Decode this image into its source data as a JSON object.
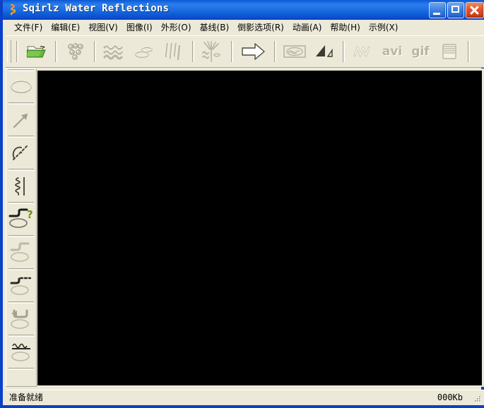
{
  "window": {
    "title": "Sqirlz Water Reflections",
    "icon": "squiggle-app-icon",
    "caption_buttons": [
      {
        "name": "minimize-button",
        "label": "_"
      },
      {
        "name": "maximize-button",
        "label": "□"
      },
      {
        "name": "close-button",
        "label": "×"
      }
    ]
  },
  "menubar": {
    "items": [
      {
        "name": "menu-file",
        "label": "文件(F)"
      },
      {
        "name": "menu-edit",
        "label": "编辑(E)"
      },
      {
        "name": "menu-view",
        "label": "视图(V)"
      },
      {
        "name": "menu-image",
        "label": "图像(I)"
      },
      {
        "name": "menu-shape",
        "label": "外形(O)"
      },
      {
        "name": "menu-baseline",
        "label": "基线(B)"
      },
      {
        "name": "menu-reflection-options",
        "label": "倒影选项(R)"
      },
      {
        "name": "menu-animation",
        "label": "动画(A)"
      },
      {
        "name": "menu-help",
        "label": "帮助(H)"
      },
      {
        "name": "menu-examples",
        "label": "示例(X)"
      }
    ]
  },
  "toolbar": {
    "buttons": [
      {
        "name": "open-file-button",
        "icon": "open-folder-icon",
        "enabled": true,
        "label": ""
      },
      {
        "name": "ripple-drops-button",
        "icon": "water-drops-icon",
        "enabled": false,
        "label": ""
      },
      {
        "name": "waves-button",
        "icon": "waves-icon",
        "enabled": false,
        "label": ""
      },
      {
        "name": "ripples-button",
        "icon": "ripple-rings-icon",
        "enabled": false,
        "label": ""
      },
      {
        "name": "rain-button",
        "icon": "rain-streaks-icon",
        "enabled": false,
        "label": ""
      },
      {
        "name": "combined-effects-button",
        "icon": "combined-effect-icon",
        "enabled": false,
        "label": ""
      },
      {
        "name": "play-button",
        "icon": "right-arrow-icon",
        "enabled": true,
        "label": ""
      },
      {
        "name": "preview-frame-button",
        "icon": "preview-frame-icon",
        "enabled": false,
        "label": ""
      },
      {
        "name": "perspective-button",
        "icon": "triangle-perspective-icon",
        "enabled": false,
        "label": ""
      },
      {
        "name": "wave-anim-button",
        "icon": "zigzag-wave-icon",
        "enabled": false,
        "label": ""
      },
      {
        "name": "export-avi-button",
        "icon": "text-label-icon",
        "enabled": false,
        "label": "avi"
      },
      {
        "name": "export-gif-button",
        "icon": "text-label-icon",
        "enabled": false,
        "label": "gif"
      },
      {
        "name": "frames-list-button",
        "icon": "stacked-lines-icon",
        "enabled": false,
        "label": ""
      }
    ]
  },
  "tool_palette": {
    "tools": [
      {
        "name": "tool-ellipse-select",
        "icon": "ellipse-icon",
        "enabled": false
      },
      {
        "name": "tool-line-draw",
        "icon": "arrow-diagonal-icon",
        "enabled": false
      },
      {
        "name": "tool-curve-edit",
        "icon": "curve-dashed-icon",
        "enabled": false
      },
      {
        "name": "tool-wave-baseline",
        "icon": "squiggle-bar-icon",
        "enabled": false
      },
      {
        "name": "tool-help-shape",
        "icon": "step-ellipse-query-icon",
        "enabled": true
      },
      {
        "name": "tool-step-shape",
        "icon": "step-ellipse-icon",
        "enabled": false
      },
      {
        "name": "tool-dashed-step-shape",
        "icon": "dashed-step-ellipse-icon",
        "enabled": false
      },
      {
        "name": "tool-arrow-step-shape",
        "icon": "arrow-step-ellipse-icon",
        "enabled": false
      },
      {
        "name": "tool-wave-line-shape",
        "icon": "wave-line-ellipse-icon",
        "enabled": false
      }
    ]
  },
  "canvas": {
    "name": "image-canvas",
    "background_color": "#000000"
  },
  "statusbar": {
    "message": "准备就绪",
    "size": "000Kb"
  },
  "colors": {
    "chrome": "#ece9d8",
    "title_blue": "#1567e0",
    "frame_blue": "#0a41c8",
    "canvas": "#000000",
    "disabled_icon": "#b9b5a2",
    "accent_green": "#3a8a1e"
  }
}
